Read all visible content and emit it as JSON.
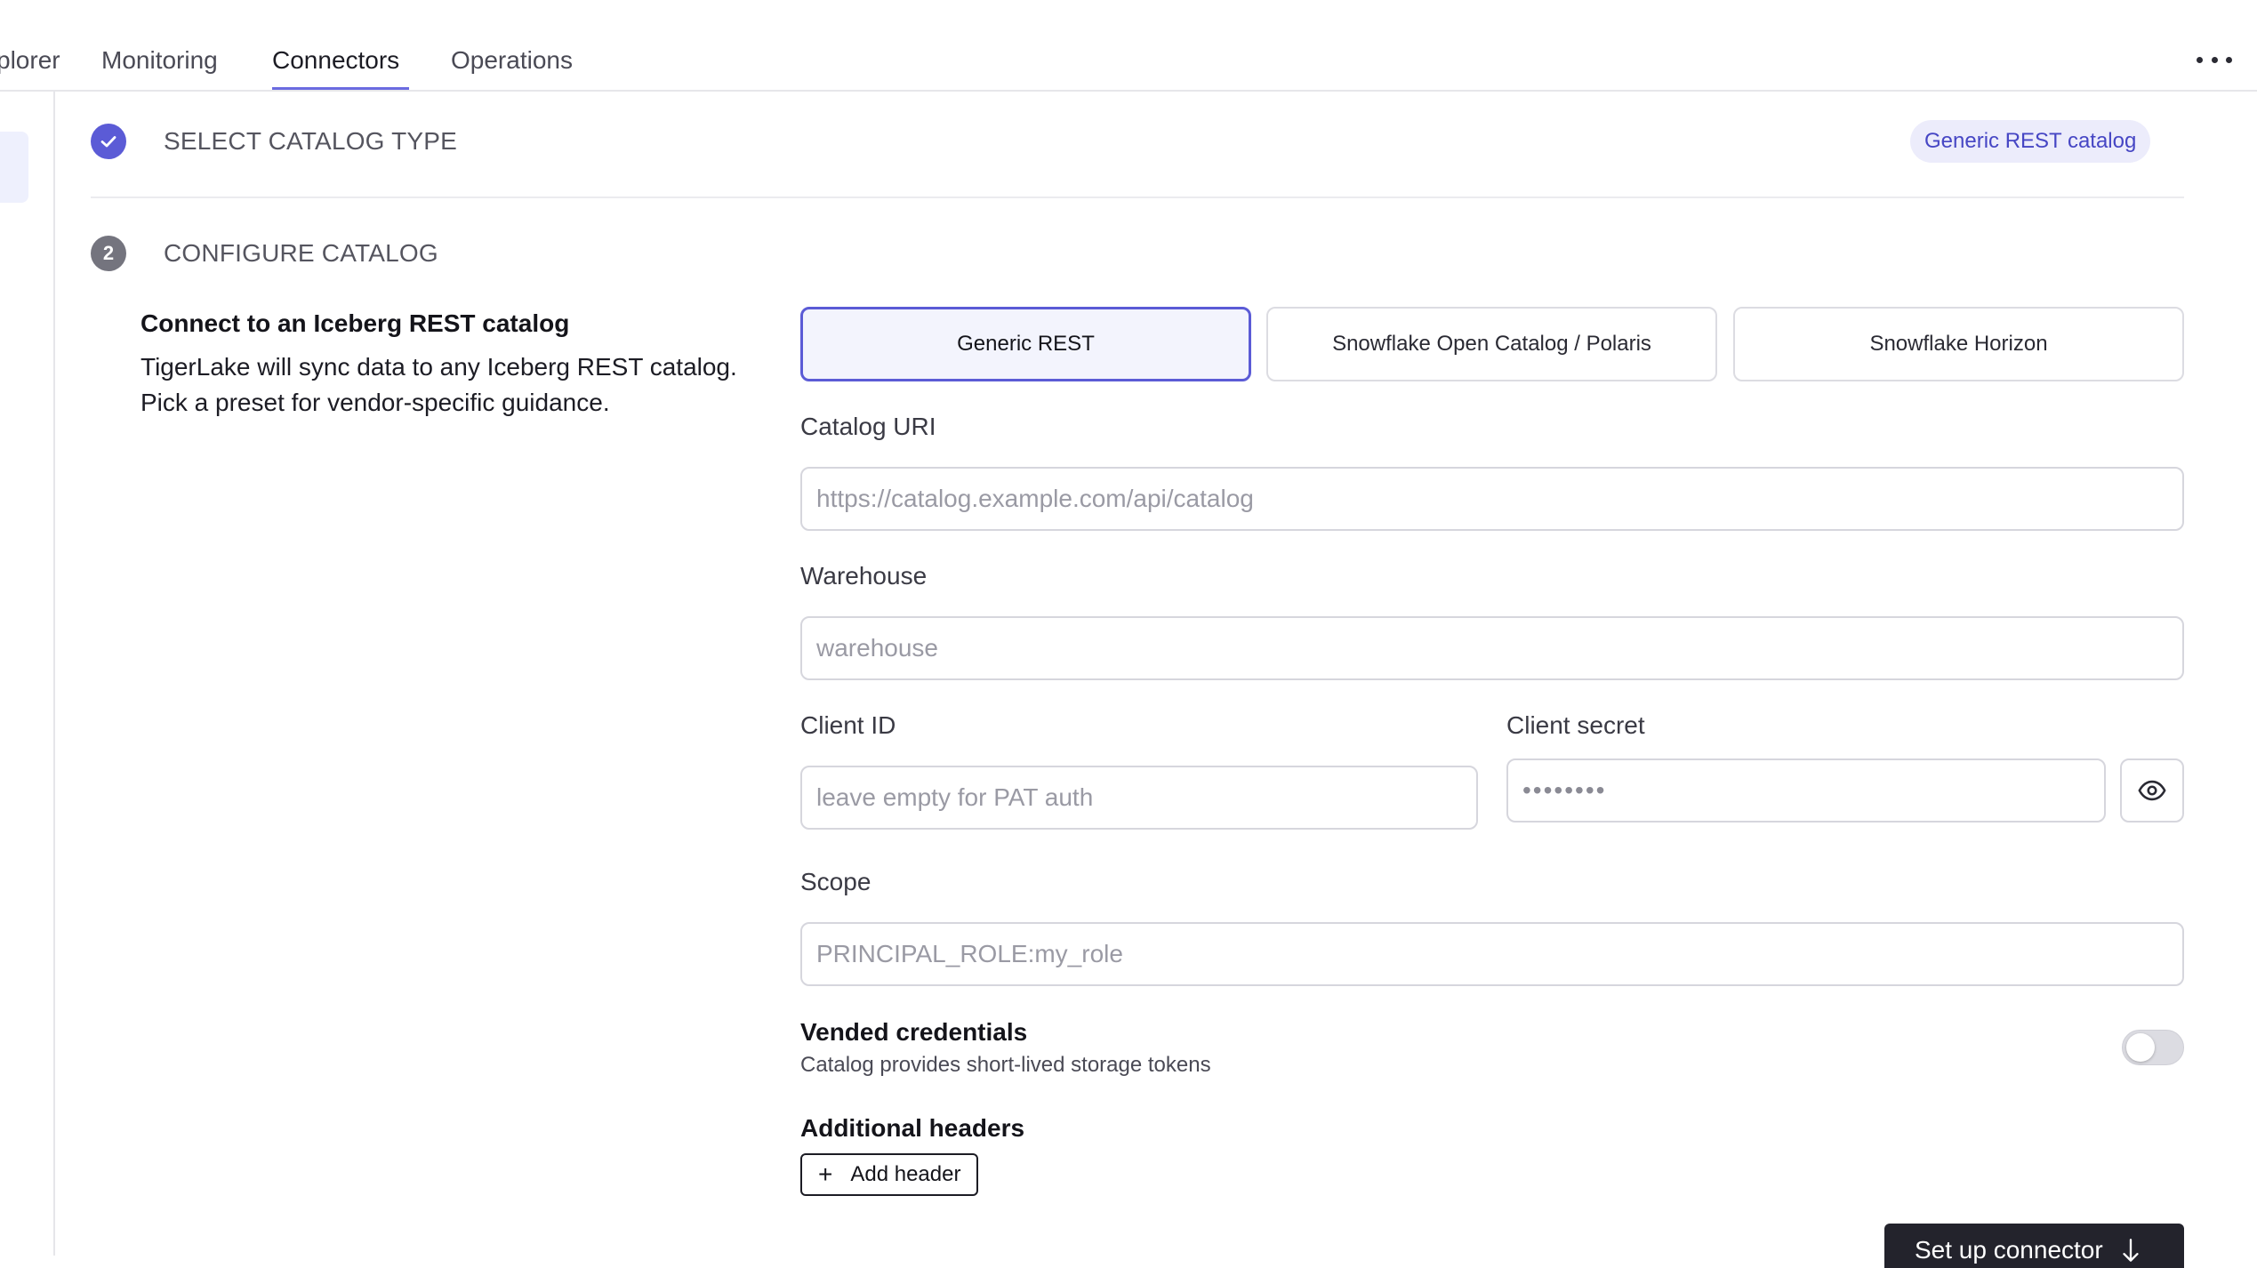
{
  "nav": {
    "tabs": [
      {
        "label": "plorer"
      },
      {
        "label": "Monitoring"
      },
      {
        "label": "Connectors"
      },
      {
        "label": "Operations"
      }
    ],
    "active_tab": "Connectors"
  },
  "steps": {
    "step1": {
      "title": "SELECT CATALOG TYPE",
      "badge": "Generic REST catalog",
      "status": "complete"
    },
    "step2": {
      "number": "2",
      "title": "CONFIGURE CATALOG"
    }
  },
  "intro": {
    "title": "Connect to an Iceberg REST catalog",
    "description": "TigerLake will sync data to any Iceberg REST catalog. Pick a preset for vendor-specific guidance."
  },
  "presets": [
    {
      "label": "Generic REST",
      "selected": true
    },
    {
      "label": "Snowflake Open Catalog / Polaris",
      "selected": false
    },
    {
      "label": "Snowflake Horizon",
      "selected": false
    }
  ],
  "fields": {
    "catalog_uri": {
      "label": "Catalog URI",
      "value": "",
      "placeholder": "https://catalog.example.com/api/catalog"
    },
    "warehouse": {
      "label": "Warehouse",
      "value": "",
      "placeholder": "warehouse"
    },
    "client_id": {
      "label": "Client ID",
      "value": "",
      "placeholder": "leave empty for PAT auth"
    },
    "client_secret": {
      "label": "Client secret",
      "value": "",
      "placeholder": "••••••••"
    },
    "scope": {
      "label": "Scope",
      "value": "",
      "placeholder": "PRINCIPAL_ROLE:my_role"
    }
  },
  "vended": {
    "title": "Vended credentials",
    "description": "Catalog provides short-lived storage tokens",
    "enabled": false
  },
  "headers": {
    "title": "Additional headers",
    "add_label": "Add header"
  },
  "actions": {
    "setup_label": "Set up connector"
  },
  "icons": {
    "step1": "check-icon",
    "reveal": "eye-icon",
    "more": "more-horizontal-icon",
    "add": "plus-icon",
    "setup": "arrow-down-icon"
  },
  "colors": {
    "accent": "#5b5bd6",
    "badge_bg": "#ececfb",
    "primary_button": "#23232c"
  }
}
